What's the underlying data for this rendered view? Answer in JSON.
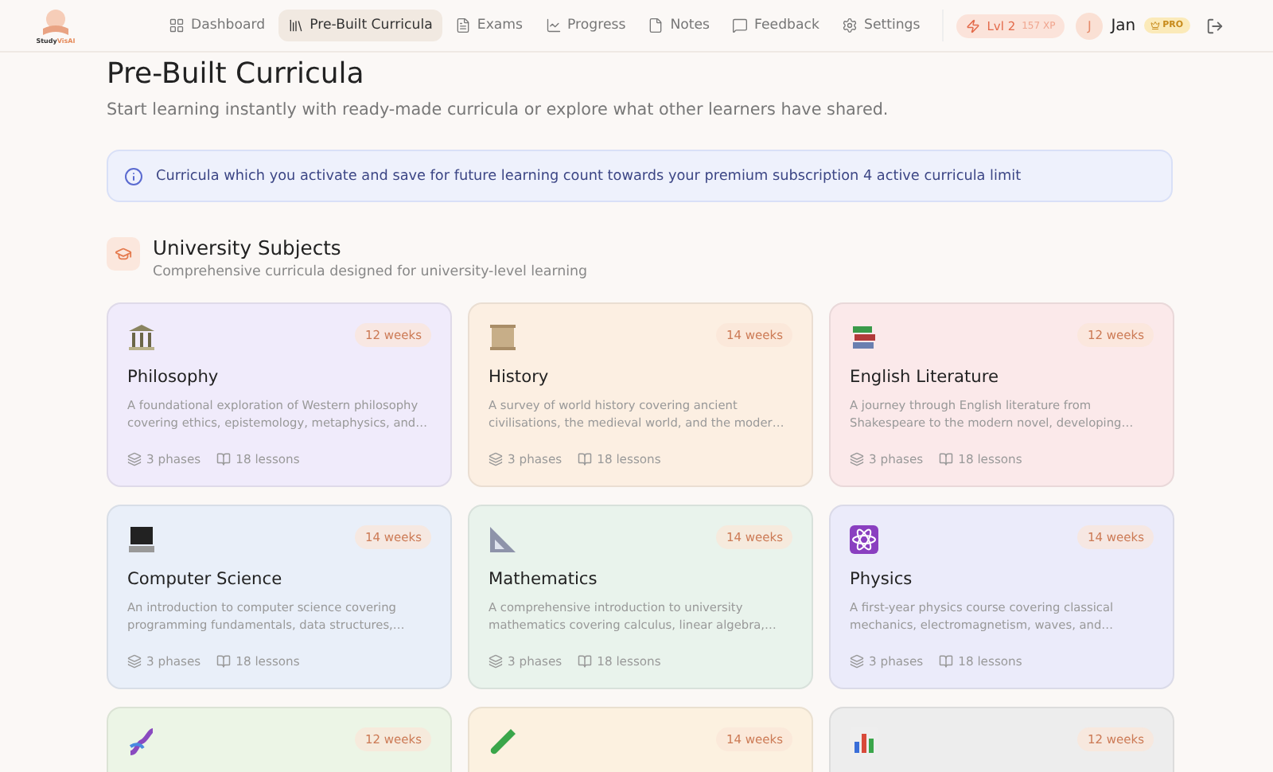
{
  "logo": {
    "text": "Study",
    "accent": "VisAI"
  },
  "nav": [
    {
      "label": "Dashboard",
      "selected": false
    },
    {
      "label": "Pre-Built Curricula",
      "selected": true
    },
    {
      "label": "Exams",
      "selected": false
    },
    {
      "label": "Progress",
      "selected": false
    },
    {
      "label": "Notes",
      "selected": false
    },
    {
      "label": "Feedback",
      "selected": false
    },
    {
      "label": "Settings",
      "selected": false
    }
  ],
  "level": {
    "label": "Lvl 2",
    "xp": "157 XP"
  },
  "user": {
    "initial": "J",
    "name": "Jan",
    "badge": "PRO"
  },
  "page": {
    "title": "Pre-Built Curricula",
    "subtitle": "Start learning instantly with ready-made curricula or explore what other learners have shared."
  },
  "notice": "Curricula which you activate and save for future learning count towards your premium subscription 4 active curricula limit",
  "section": {
    "title": "University Subjects",
    "subtitle": "Comprehensive curricula designed for university-level learning"
  },
  "cards": [
    {
      "duration": "12 weeks",
      "title": "Philosophy",
      "description": "A foundational exploration of Western philosophy covering ethics, epistemology, metaphysics, and…",
      "phases": "3 phases",
      "lessons": "18 lessons",
      "color": "#f0ebfb"
    },
    {
      "duration": "14 weeks",
      "title": "History",
      "description": "A survey of world history covering ancient civilisations, the medieval world, and the moder…",
      "phases": "3 phases",
      "lessons": "18 lessons",
      "color": "#fcefe2"
    },
    {
      "duration": "12 weeks",
      "title": "English Literature",
      "description": "A journey through English literature from Shakespeare to the modern novel, developing…",
      "phases": "3 phases",
      "lessons": "18 lessons",
      "color": "#fbe9ea"
    },
    {
      "duration": "14 weeks",
      "title": "Computer Science",
      "description": "An introduction to computer science covering programming fundamentals, data structures,…",
      "phases": "3 phases",
      "lessons": "18 lessons",
      "color": "#e9eff9"
    },
    {
      "duration": "14 weeks",
      "title": "Mathematics",
      "description": "A comprehensive introduction to university mathematics covering calculus, linear algebra,…",
      "phases": "3 phases",
      "lessons": "18 lessons",
      "color": "#e9f3ec"
    },
    {
      "duration": "14 weeks",
      "title": "Physics",
      "description": "A first-year physics course covering classical mechanics, electromagnetism, waves, and…",
      "phases": "3 phases",
      "lessons": "18 lessons",
      "color": "#ebebfa"
    },
    {
      "duration": "12 weeks",
      "color": "#ecf5e6"
    },
    {
      "duration": "14 weeks",
      "color": "#fcf1e0"
    },
    {
      "duration": "12 weeks",
      "color": "#ededed"
    }
  ]
}
